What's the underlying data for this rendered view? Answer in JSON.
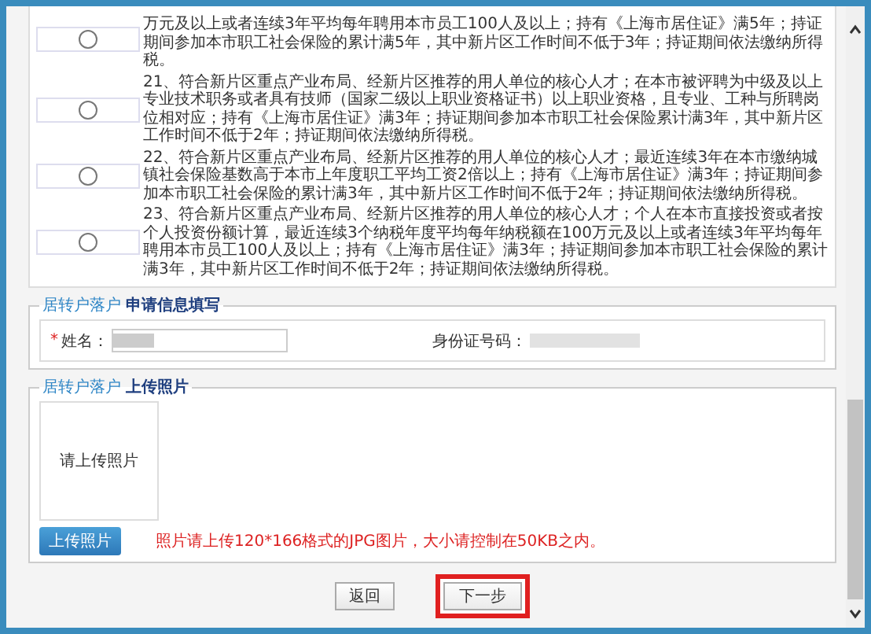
{
  "options": [
    {
      "text": "万元及以上或者连续3年平均每年聘用本市员工100人及以上；持有《上海市居住证》满5年；持证期间参加本市职工社会保险的累计满5年，其中新片区工作时间不低于3年；持证期间依法缴纳所得税。",
      "selected": false
    },
    {
      "number": "21、",
      "text": "符合新片区重点产业布局、经新片区推荐的用人单位的核心人才；在本市被评聘为中级及以上专业技术职务或者具有技师（国家二级以上职业资格证书）以上职业资格，且专业、工种与所聘岗位相对应；持有《上海市居住证》满3年；持证期间参加本市职工社会保险累计满3年，其中新片区工作时间不低于2年；持证期间依法缴纳所得税。",
      "selected": false
    },
    {
      "number": "22、",
      "text": "符合新片区重点产业布局、经新片区推荐的用人单位的核心人才；最近连续3年在本市缴纳城镇社会保险基数高于本市上年度职工平均工资2倍以上；持有《上海市居住证》满3年；持证期间参加本市职工社会保险的累计满3年，其中新片区工作时间不低于2年；持证期间依法缴纳所得税。",
      "selected": false
    },
    {
      "number": "23、",
      "text": "符合新片区重点产业布局、经新片区推荐的用人单位的核心人才；个人在本市直接投资或者按个人投资份额计算，最近连续3个纳税年度平均每年纳税额在100万元及以上或者连续3年平均每年聘用本市员工100人及以上；持有《上海市居住证》满3年；持证期间参加本市职工社会保险的累计满3年，其中新片区工作时间不低于2年；持证期间依法缴纳所得税。",
      "selected": false
    }
  ],
  "info_section": {
    "legend_prefix": "居转户落户",
    "legend_title": "申请信息填写",
    "name_label": "姓名：",
    "required_mark": "*",
    "id_label": "身份证号码："
  },
  "photo_section": {
    "legend_prefix": "居转户落户",
    "legend_title": "上传照片",
    "photo_hint": "请上传照片",
    "upload_button": "上传照片",
    "note": "照片请上传120*166格式的JPG图片，大小请控制在50KB之内。"
  },
  "buttons": [
    {
      "label": "返回",
      "highlighted": false
    },
    {
      "label": "下一步",
      "highlighted": true
    }
  ]
}
